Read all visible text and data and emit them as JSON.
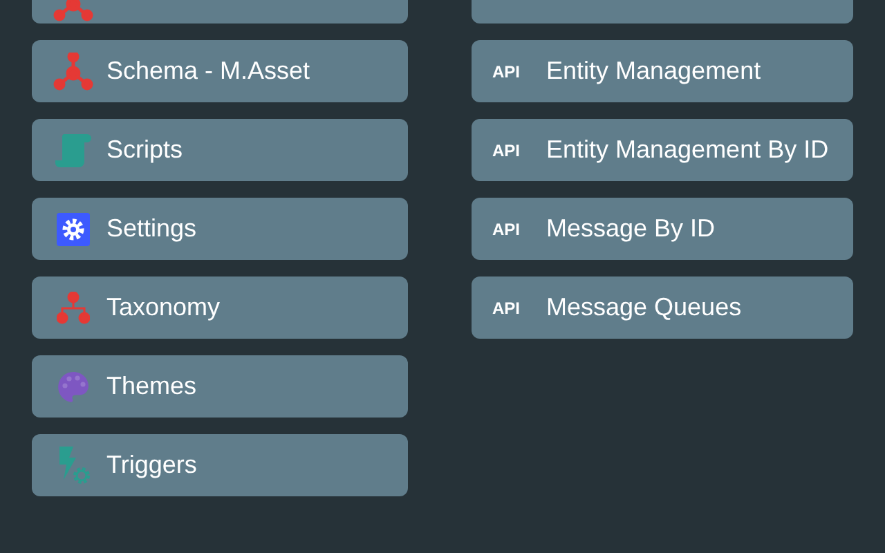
{
  "left_items": [
    {
      "label": "Schema - M.Asset"
    },
    {
      "label": "Scripts"
    },
    {
      "label": "Settings"
    },
    {
      "label": "Taxonomy"
    },
    {
      "label": "Themes"
    },
    {
      "label": "Triggers"
    }
  ],
  "right_items": [
    {
      "badge": "API",
      "label": "Entity Management"
    },
    {
      "badge": "API",
      "label": "Entity Management By ID"
    },
    {
      "badge": "API",
      "label": "Message By ID"
    },
    {
      "badge": "API",
      "label": "Message Queues"
    }
  ]
}
